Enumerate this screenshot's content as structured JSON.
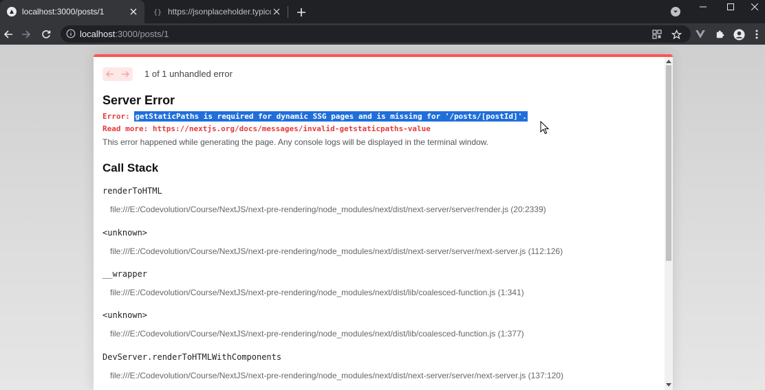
{
  "browser": {
    "tabs": [
      {
        "title": "localhost:3000/posts/1",
        "favicon": "nextjs-logo-icon"
      },
      {
        "title": "https://jsonplaceholder.typicode.",
        "favicon": "jsonplaceholder-favicon-icon"
      }
    ],
    "address": {
      "host": "localhost",
      "path": ":3000/posts/1"
    }
  },
  "overlay": {
    "error_count": "1 of 1 unhandled error",
    "title": "Server Error",
    "error_prefix": "Error: ",
    "error_message": "getStaticPaths is required for dynamic SSG pages and is missing for '/posts/[postId]'.",
    "read_more": "Read more: https://nextjs.org/docs/messages/invalid-getstaticpaths-value",
    "description": "This error happened while generating the page. Any console logs will be displayed in the terminal window.",
    "call_stack_title": "Call Stack",
    "frames": [
      {
        "name": "renderToHTML",
        "file": "file:///E:/Codevolution/Course/NextJS/next-pre-rendering/node_modules/next/dist/next-server/server/render.js (20:2339)"
      },
      {
        "name": "<unknown>",
        "file": "file:///E:/Codevolution/Course/NextJS/next-pre-rendering/node_modules/next/dist/next-server/server/next-server.js (112:126)"
      },
      {
        "name": "__wrapper",
        "file": "file:///E:/Codevolution/Course/NextJS/next-pre-rendering/node_modules/next/dist/lib/coalesced-function.js (1:341)"
      },
      {
        "name": "<unknown>",
        "file": "file:///E:/Codevolution/Course/NextJS/next-pre-rendering/node_modules/next/dist/lib/coalesced-function.js (1:377)"
      },
      {
        "name": "DevServer.renderToHTMLWithComponents",
        "file": "file:///E:/Codevolution/Course/NextJS/next-pre-rendering/node_modules/next/dist/next-server/server/next-server.js (137:120)"
      }
    ]
  },
  "colors": {
    "accent_red": "#ff5555",
    "error_text": "#e5383b",
    "selection": "#1f6fdb"
  }
}
